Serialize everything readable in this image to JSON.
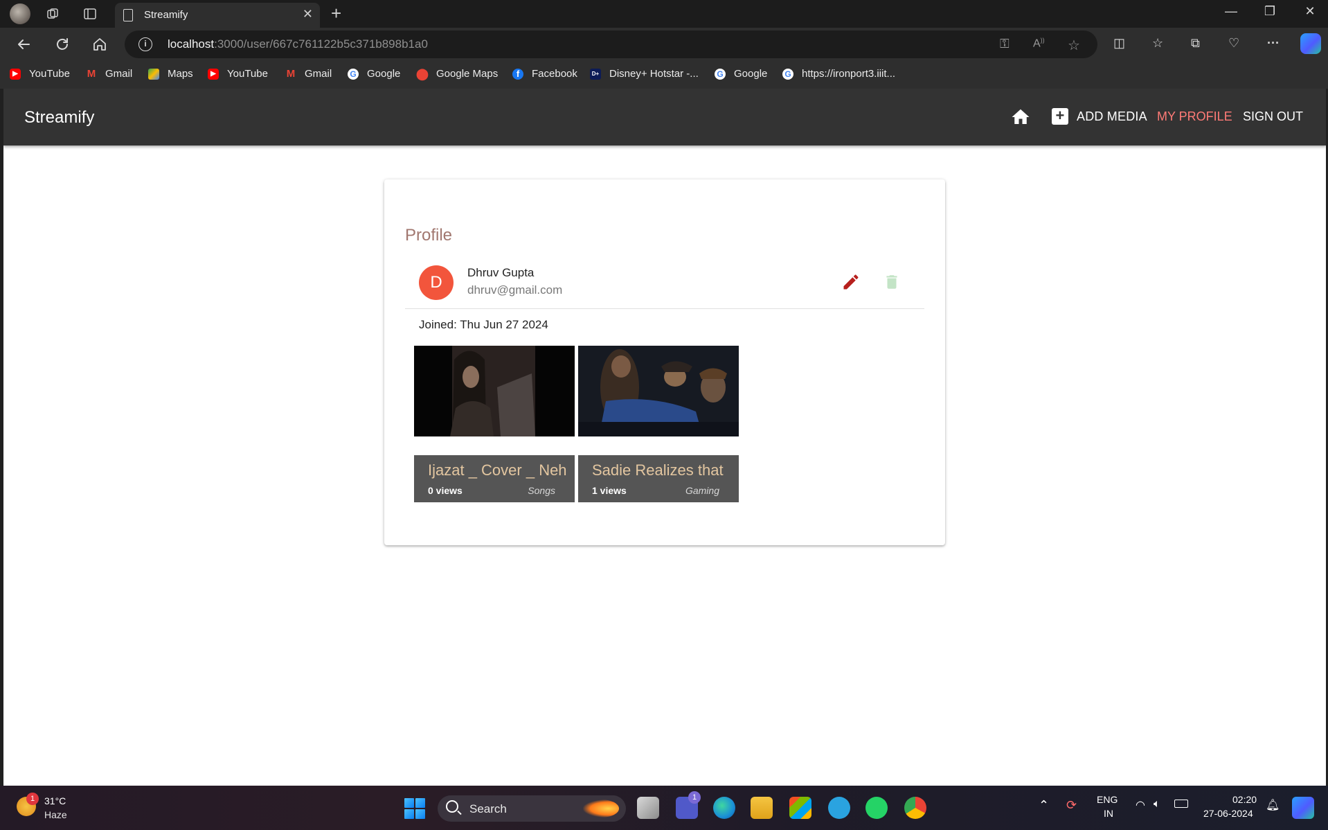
{
  "browser": {
    "tab_title": "Streamify",
    "url_host": "localhost",
    "url_rest": ":3000/user/667c761122b5c371b898b1a0",
    "bookmarks": [
      {
        "label": "YouTube",
        "icon": "youtube-icon"
      },
      {
        "label": "Gmail",
        "icon": "gmail-icon"
      },
      {
        "label": "Maps",
        "icon": "maps-icon"
      },
      {
        "label": "YouTube",
        "icon": "youtube-icon"
      },
      {
        "label": "Gmail",
        "icon": "gmail-icon"
      },
      {
        "label": "Google",
        "icon": "google-icon"
      },
      {
        "label": "Google Maps",
        "icon": "google-maps-icon"
      },
      {
        "label": "Facebook",
        "icon": "facebook-icon"
      },
      {
        "label": "Disney+ Hotstar -...",
        "icon": "hotstar-icon"
      },
      {
        "label": "Google",
        "icon": "google-icon"
      },
      {
        "label": "https://ironport3.iiit...",
        "icon": "google-icon"
      }
    ]
  },
  "app": {
    "brand": "Streamify",
    "nav": {
      "add_media": "ADD MEDIA",
      "my_profile": "MY PROFILE",
      "sign_out": "SIGN OUT"
    },
    "accent_color": "#ff7b77"
  },
  "profile": {
    "title": "Profile",
    "avatar_letter": "D",
    "name": "Dhruv Gupta",
    "email": "dhruv@gmail.com",
    "joined": "Joined: Thu Jun 27 2024",
    "media": [
      {
        "title": "Ijazat _ Cover _ Neh",
        "views": "0 views",
        "genre": "Songs"
      },
      {
        "title": "Sadie Realizes that",
        "views": "1 views",
        "genre": "Gaming"
      }
    ]
  },
  "taskbar": {
    "weather_badge": "1",
    "temperature": "31°C",
    "weather": "Haze",
    "search": "Search",
    "teams_badge": "1",
    "lang_top": "ENG",
    "lang_bottom": "IN",
    "time": "02:20",
    "date": "27-06-2024"
  }
}
